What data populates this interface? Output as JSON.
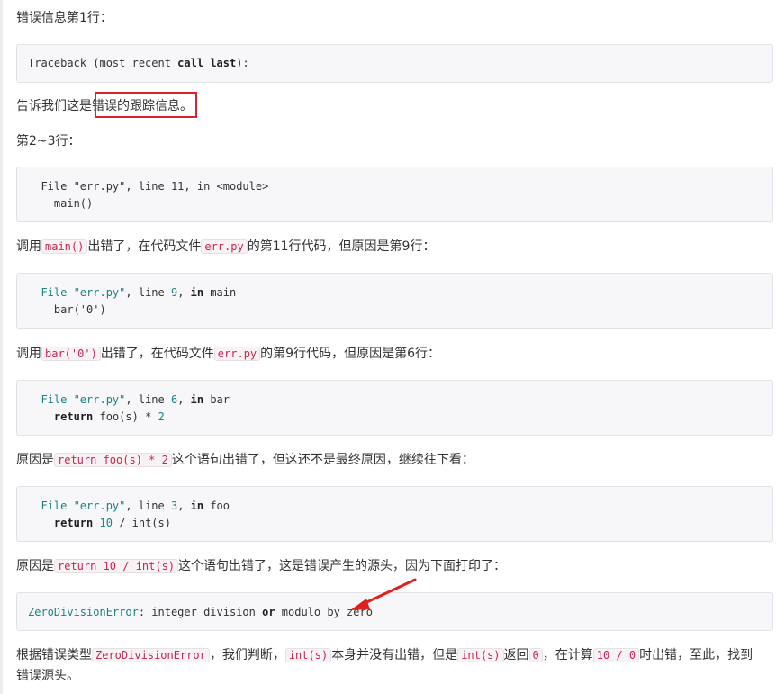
{
  "para_line1": "错误信息第1行：",
  "code1": {
    "l1_pre": "Traceback (most recent ",
    "l1_kw1": "call",
    "l1_sp": " ",
    "l1_kw2": "last",
    "l1_post": "):"
  },
  "para_traceback": {
    "pre": "告诉我们这是",
    "highlight": "错误的跟踪信息",
    "post": "。"
  },
  "para_lines23": "第2~3行：",
  "code2": {
    "l1": "  File \"err.py\", line 11, in <module>",
    "l2": "    main()"
  },
  "para_main": {
    "p1": "调用",
    "c1": "main()",
    "p2": "出错了，在代码文件",
    "c2": "err.py",
    "p3": "的第11行代码，但原因是第9行："
  },
  "code3": {
    "file": "File",
    "str": " \"err.py\"",
    "rest1": ", line ",
    "num": "9",
    "rest2": ", ",
    "kw": "in",
    "rest3": " main",
    "l2": "    bar('0')"
  },
  "para_bar": {
    "p1": "调用",
    "c1": "bar('0')",
    "p2": "出错了，在代码文件",
    "c2": "err.py",
    "p3": "的第9行代码，但原因是第6行："
  },
  "code4": {
    "file": "File",
    "str": " \"err.py\"",
    "rest1": ", line ",
    "num": "6",
    "rest2": ", ",
    "kw": "in",
    "rest3": " bar",
    "l2_kw": "return",
    "l2_mid": " foo(s) * ",
    "l2_num": "2"
  },
  "para_foo": {
    "p1": "原因是",
    "c1": "return foo(s) * 2",
    "p2": "这个语句出错了，但这还不是最终原因，继续往下看："
  },
  "code5": {
    "file": "File",
    "str": " \"err.py\"",
    "rest1": ", line ",
    "num": "3",
    "rest2": ", ",
    "kw": "in",
    "rest3": " foo",
    "l2_kw": "return",
    "l2_sp": " ",
    "l2_num": "10",
    "l2_rest": " / int(s)"
  },
  "para_int": {
    "p1": "原因是",
    "c1": "return 10 / int(s)",
    "p2": "这个语句出错了，这是错误产生的源头，因为下面打印了："
  },
  "code6": {
    "err": "ZeroDivisionError",
    "mid": ": integer division ",
    "kw": "or",
    "post": " modulo by zero"
  },
  "para_final": {
    "p1": "根据错误类型",
    "c1": "ZeroDivisionError",
    "p2": "，我们判断，",
    "c2": "int(s)",
    "p3": "本身并没有出错，但是",
    "c3": "int(s)",
    "p4": "返回",
    "c4": "0",
    "p5": "，在计算",
    "c5": "10 / 0",
    "p6": "时出错，至此，找到错误源头。"
  },
  "colors": {
    "highlight_box": "#d8252b",
    "arrow": "#e02020",
    "inline_code_text": "#c7254e",
    "code_bg": "#f7f7f9"
  }
}
